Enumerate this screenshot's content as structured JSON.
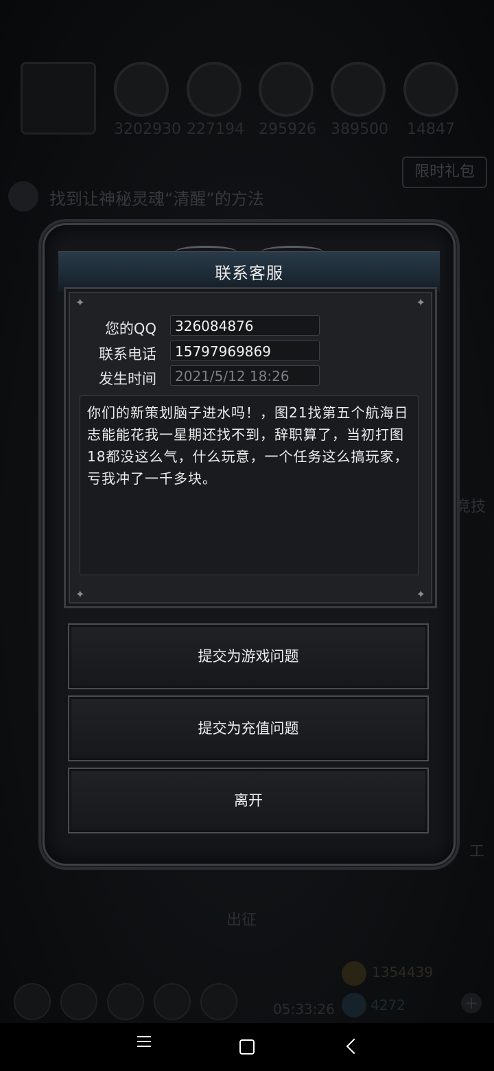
{
  "background": {
    "resources": [
      "3202930",
      "227194",
      "295926",
      "389500",
      "14847"
    ],
    "limited_gift_label": "限时礼包",
    "quest_text": "找到让神秘灵魂“清醒”的方法",
    "side_label_right": "竞技",
    "side_label_work": "工",
    "sortie_label": "出征",
    "clock": "05:33:26",
    "gold_amount": "1354439",
    "gem_amount": "4272",
    "plus_symbol": "+"
  },
  "dialog": {
    "title": "联系客服",
    "fields": [
      {
        "label": "您的QQ",
        "value": "326084876",
        "readonly": false
      },
      {
        "label": "联系电话",
        "value": "15797969869",
        "readonly": false
      },
      {
        "label": "发生时间",
        "value": "2021/5/12 18:26",
        "readonly": true
      }
    ],
    "message": "你们的新策划脑子进水吗！，图21找第五个航海日志能能花我一星期还找不到，辞职算了，当初打图18都没这么气，什么玩意，一个任务这么搞玩家，亏我冲了一千多块。",
    "buttons": {
      "game_issue": "提交为游戏问题",
      "recharge_issue": "提交为充值问题",
      "leave": "离开"
    }
  },
  "navbar": {
    "icons": [
      "menu-icon",
      "home-icon",
      "back-icon"
    ]
  }
}
